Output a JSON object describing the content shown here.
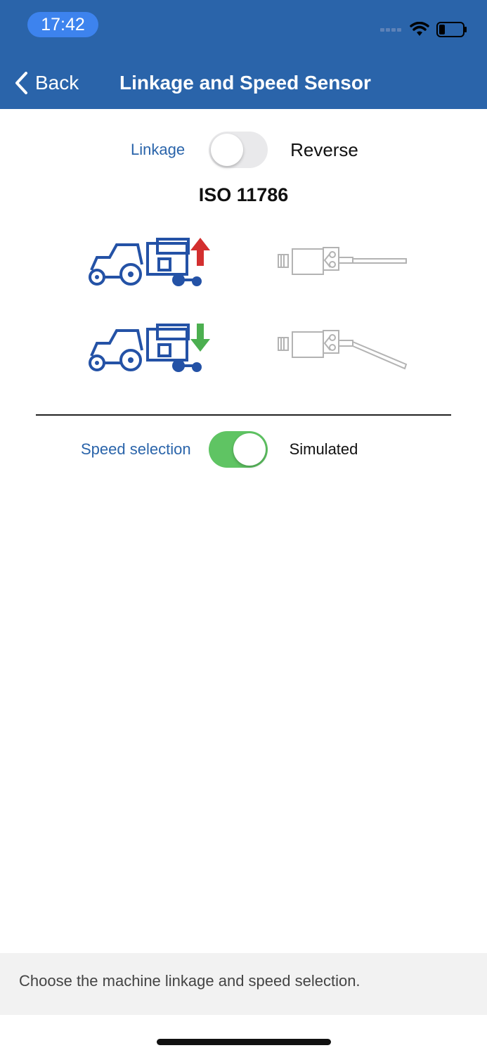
{
  "status_bar": {
    "time": "17:42"
  },
  "nav": {
    "back_label": "Back",
    "title": "Linkage and Speed Sensor"
  },
  "linkage": {
    "label": "Linkage",
    "toggle_on": false,
    "option_label": "Reverse"
  },
  "iso_title": "ISO 11786",
  "speed": {
    "label": "Speed selection",
    "toggle_on": true,
    "option_label": "Simulated"
  },
  "footer": {
    "hint": "Choose the machine linkage and speed selection."
  },
  "colors": {
    "header": "#2a64aa",
    "accent_blue": "#2a64aa",
    "toggle_on": "#5fc463",
    "arrow_up": "#d32f2f",
    "arrow_down": "#4caf50"
  }
}
